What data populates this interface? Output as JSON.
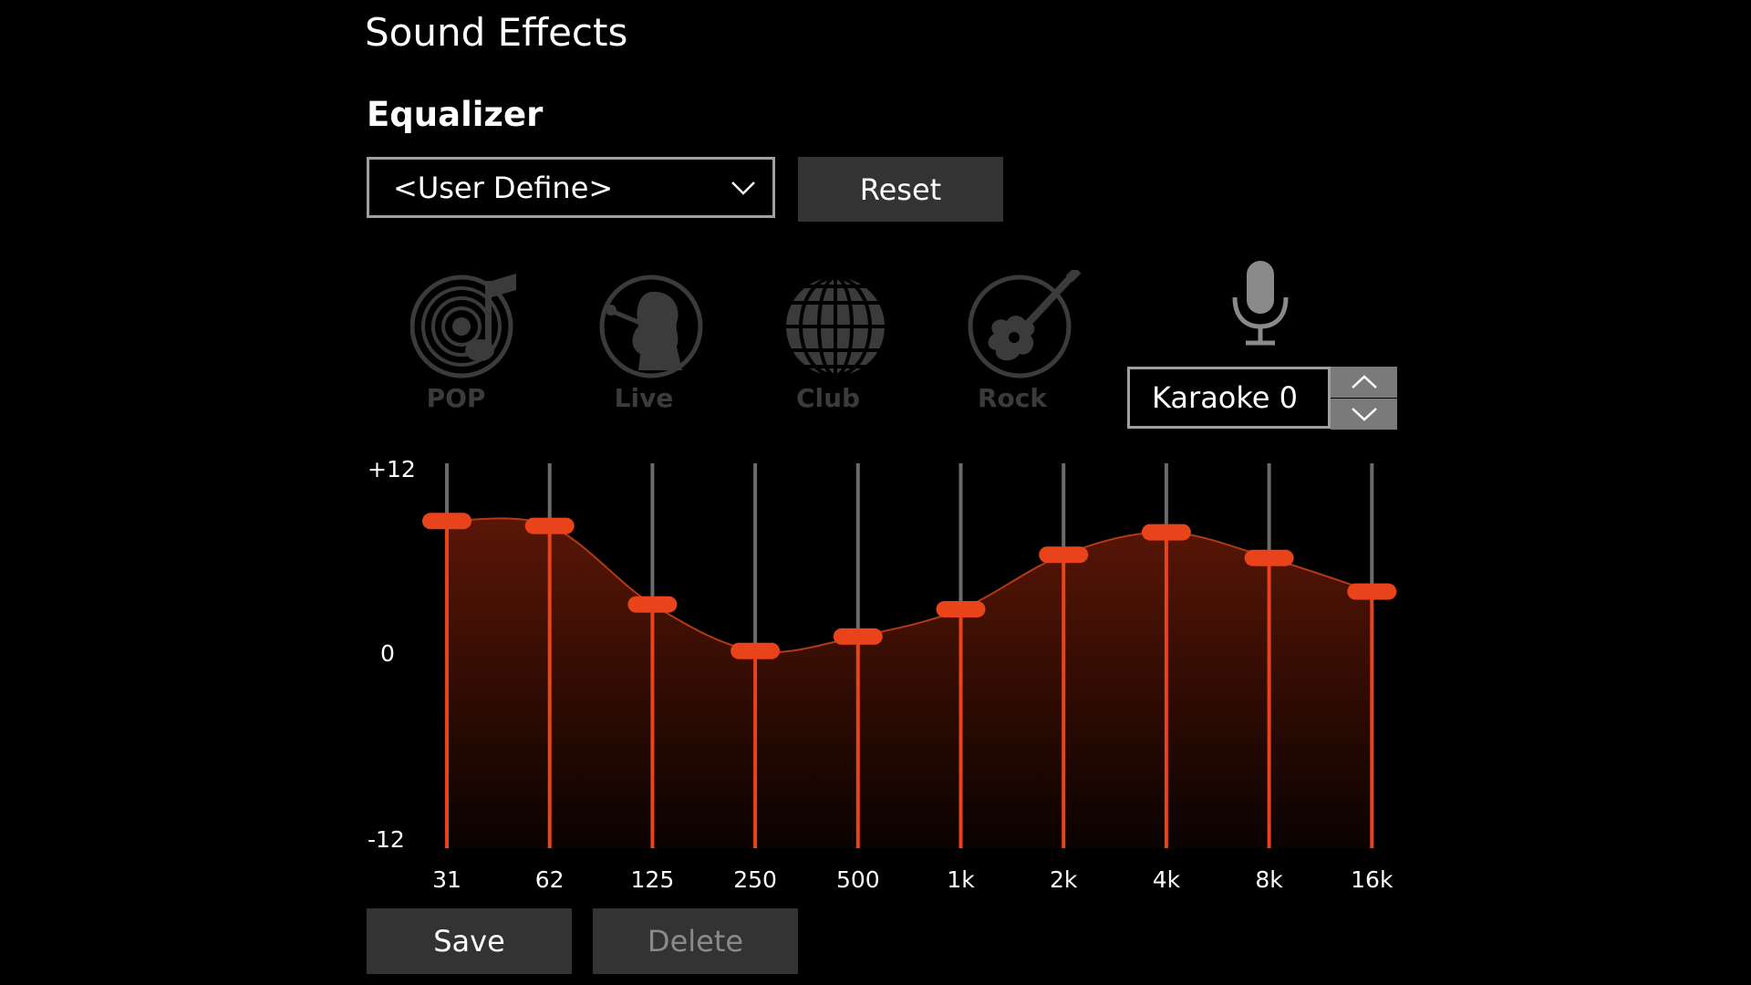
{
  "page": {
    "title": "Sound Effects"
  },
  "equalizer": {
    "section_title": "Equalizer",
    "preset_selected": "<User Define>",
    "reset_label": "Reset"
  },
  "presets": [
    {
      "label": "POP",
      "icon": "vinyl-music-icon"
    },
    {
      "label": "Live",
      "icon": "singer-icon"
    },
    {
      "label": "Club",
      "icon": "disco-ball-icon"
    },
    {
      "label": "Rock",
      "icon": "guitar-icon"
    }
  ],
  "karaoke": {
    "icon": "microphone-icon",
    "value_text": "Karaoke 0"
  },
  "scale": {
    "max_label": "+12",
    "mid_label": "0",
    "min_label": "-12",
    "max": 12,
    "min": -12
  },
  "bands": [
    {
      "freq": "31",
      "gain": 8.4
    },
    {
      "freq": "62",
      "gain": 8.1
    },
    {
      "freq": "125",
      "gain": 3.2
    },
    {
      "freq": "250",
      "gain": 0.3
    },
    {
      "freq": "500",
      "gain": 1.2
    },
    {
      "freq": "1k",
      "gain": 2.9
    },
    {
      "freq": "2k",
      "gain": 6.3
    },
    {
      "freq": "4k",
      "gain": 7.7
    },
    {
      "freq": "8k",
      "gain": 6.1
    },
    {
      "freq": "16k",
      "gain": 4.0
    }
  ],
  "colors": {
    "accent": "#e8431a",
    "track": "#6b6b6b",
    "button_bg": "#333333",
    "icon_gray": "#3b3b3b"
  },
  "footer": {
    "save_label": "Save",
    "delete_label": "Delete"
  }
}
